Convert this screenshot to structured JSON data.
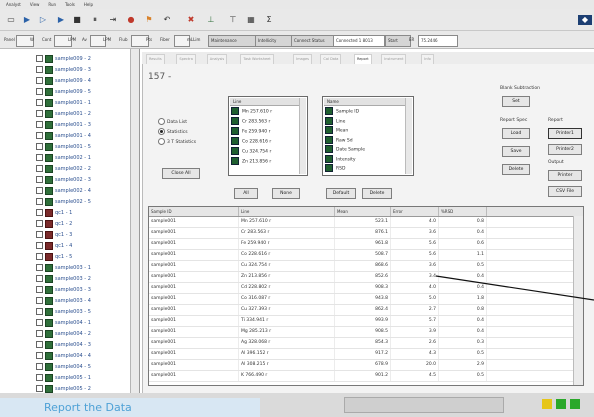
{
  "menu": [
    "Analyst",
    "View",
    "Run",
    "Tools",
    "Help"
  ],
  "toolbar2": {
    "items": [
      "Panel",
      "W",
      "Cont",
      "LPM",
      "Av",
      "LPM",
      "Flub",
      "Pts",
      "Fiber",
      "mLLim"
    ],
    "maintenance": "Maintenance",
    "intellicity": "Intellicity",
    "connect_status": "Connect Status",
    "connection": "Connected 1 8013",
    "start": "Start",
    "ref": "ER",
    "ref_value": "75.2446"
  },
  "tree": [
    {
      "label": "sample009 - 2",
      "kind": "ok"
    },
    {
      "label": "sample009 - 3",
      "kind": "ok"
    },
    {
      "label": "sample009 - 4",
      "kind": "ok"
    },
    {
      "label": "sample009 - 5",
      "kind": "ok"
    },
    {
      "label": "sample001 - 1",
      "kind": "ok"
    },
    {
      "label": "sample001 - 2",
      "kind": "ok"
    },
    {
      "label": "sample001 - 3",
      "kind": "ok"
    },
    {
      "label": "sample001 - 4",
      "kind": "ok"
    },
    {
      "label": "sample001 - 5",
      "kind": "ok"
    },
    {
      "label": "sample002 - 1",
      "kind": "ok"
    },
    {
      "label": "sample002 - 2",
      "kind": "ok"
    },
    {
      "label": "sample002 - 3",
      "kind": "ok"
    },
    {
      "label": "sample002 - 4",
      "kind": "ok"
    },
    {
      "label": "sample002 - 5",
      "kind": "ok"
    },
    {
      "label": "qc1 - 1",
      "kind": "qc"
    },
    {
      "label": "qc1 - 2",
      "kind": "qc"
    },
    {
      "label": "qc1 - 3",
      "kind": "qc"
    },
    {
      "label": "qc1 - 4",
      "kind": "qc"
    },
    {
      "label": "qc1 - 5",
      "kind": "qc"
    },
    {
      "label": "sample003 - 1",
      "kind": "ok"
    },
    {
      "label": "sample003 - 2",
      "kind": "ok"
    },
    {
      "label": "sample003 - 3",
      "kind": "ok"
    },
    {
      "label": "sample003 - 4",
      "kind": "ok"
    },
    {
      "label": "sample003 - 5",
      "kind": "ok"
    },
    {
      "label": "sample004 - 1",
      "kind": "ok"
    },
    {
      "label": "sample004 - 2",
      "kind": "ok"
    },
    {
      "label": "sample004 - 3",
      "kind": "ok"
    },
    {
      "label": "sample004 - 4",
      "kind": "ok"
    },
    {
      "label": "sample004 - 5",
      "kind": "ok"
    },
    {
      "label": "sample005 - 1",
      "kind": "ok"
    },
    {
      "label": "sample005 - 2",
      "kind": "ok"
    }
  ],
  "tabs": [
    "Results",
    "Spectra",
    "Analysis",
    "Task Worksheet",
    "Images",
    "Cal Data",
    "Report",
    "Instrument",
    "Info"
  ],
  "active_tab": "Report",
  "page_title": "157 -",
  "modes": {
    "options": [
      "Data List",
      "Statistics",
      "3 T Statistics"
    ],
    "selected": "Statistics"
  },
  "elements_list": {
    "header": "Line",
    "items": [
      "Mn 257.610 r",
      "Cr 283.563 r",
      "Fe 259.940 r",
      "Co 228.616 r",
      "Cu 324.754 r",
      "Zn 213.856 r"
    ],
    "all_label": "All",
    "none_label": "None"
  },
  "fields_list": {
    "header": "Name",
    "items": [
      "Sample ID",
      "Line",
      "Mean",
      "Raw Sd",
      "Date Sample",
      "Intensity",
      "RSD"
    ],
    "default_label": "Default",
    "delete_label": "Delete"
  },
  "close_all_label": "Close All",
  "blank_subtraction": {
    "label": "Blank Subtraction",
    "button": "Set"
  },
  "report_spec": {
    "label": "Report Spec",
    "load": "Load",
    "save": "Save",
    "delete": "Delete"
  },
  "report": {
    "label": "Report",
    "printer1": "Printer1",
    "printer2": "Printer2"
  },
  "output": {
    "label": "Output",
    "printer": "Printer",
    "csv": "CSV File"
  },
  "grid": {
    "headers": [
      "Sample ID",
      "Line",
      "Mean",
      "Error",
      "%RSD"
    ],
    "rows": [
      [
        "sample001",
        "Mn 257.610 r",
        "523.1",
        "4.0",
        "0.8"
      ],
      [
        "sample001",
        "Cr 283.563 r",
        "876.1",
        "3.6",
        "0.4"
      ],
      [
        "sample001",
        "Fe 259.940 r",
        "961.8",
        "5.6",
        "0.6"
      ],
      [
        "sample001",
        "Co 228.616 r",
        "508.7",
        "5.6",
        "1.1"
      ],
      [
        "sample001",
        "Cu 324.754 r",
        "868.6",
        "3.6",
        "0.5"
      ],
      [
        "sample001",
        "Zn 213.856 r",
        "852.6",
        "3.4",
        "0.4"
      ],
      [
        "sample001",
        "Cd 228.802 r",
        "908.3",
        "4.0",
        "0.4"
      ],
      [
        "sample001",
        "Co 316.087 r",
        "943.8",
        "5.0",
        "1.8"
      ],
      [
        "sample001",
        "Cu 327.393 r",
        "862.4",
        "2.7",
        "0.8"
      ],
      [
        "sample001",
        "Ti 334.941 r",
        "993.9",
        "5.7",
        "0.4"
      ],
      [
        "sample001",
        "Mg 285.213 r",
        "908.5",
        "3.9",
        "0.4"
      ],
      [
        "sample001",
        "Ag 328.068 r",
        "854.3",
        "2.6",
        "0.3"
      ],
      [
        "sample001",
        "Al 396.152 r",
        "917.2",
        "4.3",
        "0.5"
      ],
      [
        "sample001",
        "Al 308.215 r",
        "678.9",
        "20.0",
        "2.9"
      ],
      [
        "sample001",
        "K 766.490 r",
        "901.2",
        "4.5",
        "0.5"
      ]
    ]
  },
  "caption": "Report the Data"
}
